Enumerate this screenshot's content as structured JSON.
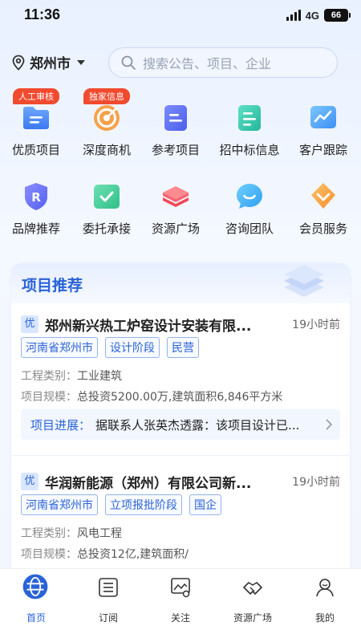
{
  "status_bar": {
    "time": "11:36",
    "network": "4G",
    "battery": "66"
  },
  "header": {
    "city": "郑州市",
    "search_placeholder": "搜索公告、项目、企业"
  },
  "grid": [
    {
      "label": "优质项目",
      "badge": "人工审核",
      "icon": "folder-icon"
    },
    {
      "label": "深度商机",
      "badge": "独家信息",
      "icon": "target-icon"
    },
    {
      "label": "参考项目",
      "badge": "",
      "icon": "document-icon"
    },
    {
      "label": "招中标信息",
      "badge": "",
      "icon": "notes-icon"
    },
    {
      "label": "客户跟踪",
      "badge": "",
      "icon": "trend-icon"
    },
    {
      "label": "品牌推荐",
      "badge": "",
      "icon": "shield-r-icon"
    },
    {
      "label": "委托承接",
      "badge": "",
      "icon": "check-box-icon"
    },
    {
      "label": "资源广场",
      "badge": "",
      "icon": "layers-icon"
    },
    {
      "label": "咨询团队",
      "badge": "",
      "icon": "chat-smile-icon"
    },
    {
      "label": "会员服务",
      "badge": "",
      "icon": "vip-diamond-icon"
    }
  ],
  "recommend": {
    "title": "项目推荐",
    "projects": [
      {
        "badge": "优",
        "name": "郑州新兴热工炉窑设计安装有限...",
        "time": "19小时前",
        "tags": [
          "河南省郑州市",
          "设计阶段",
          "民营"
        ],
        "category_key": "工程类别：",
        "category": "工业建筑",
        "scale_key": "项目规模：",
        "scale": "总投资5200.00万,建筑面积6,846平方米",
        "progress_key": "项目进展：",
        "progress": "据联系人张英杰透露：该项目设计已..."
      },
      {
        "badge": "优",
        "name": "华润新能源（郑州）有限公司新...",
        "time": "19小时前",
        "tags": [
          "河南省郑州市",
          "立项报批阶段",
          "国企"
        ],
        "category_key": "工程类别：",
        "category": "风电工程",
        "scale_key": "项目规模：",
        "scale": "总投资12亿,建筑面积/"
      }
    ]
  },
  "bottom_nav": [
    {
      "label": "首页",
      "icon": "home-globe-icon",
      "active": true
    },
    {
      "label": "订阅",
      "icon": "subscribe-list-icon",
      "active": false
    },
    {
      "label": "关注",
      "icon": "follow-image-icon",
      "active": false
    },
    {
      "label": "资源广场",
      "icon": "handshake-icon",
      "active": false
    },
    {
      "label": "我的",
      "icon": "profile-icon",
      "active": false
    }
  ],
  "colors": {
    "accent": "#2a63d8",
    "badge": "#f04a2f",
    "text": "#222222"
  }
}
